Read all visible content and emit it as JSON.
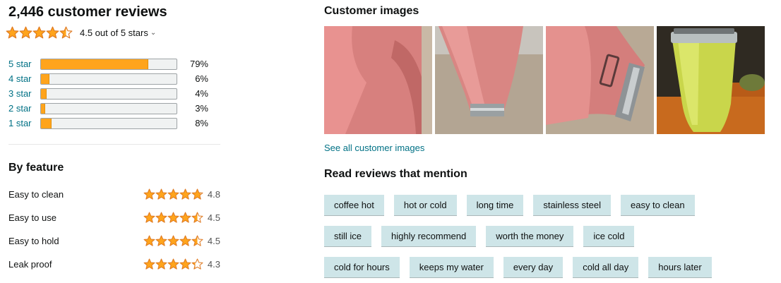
{
  "header": {
    "total_reviews": "2,446 customer reviews",
    "rating_text": "4.5 out of 5 stars",
    "rating_value": 4.5,
    "caret": "⌄"
  },
  "histogram": [
    {
      "label": "5 star",
      "percent_text": "79%",
      "percent": 0.79
    },
    {
      "label": "4 star",
      "percent_text": "6%",
      "percent": 0.06
    },
    {
      "label": "3 star",
      "percent_text": "4%",
      "percent": 0.04
    },
    {
      "label": "2 star",
      "percent_text": "3%",
      "percent": 0.03
    },
    {
      "label": "1 star",
      "percent_text": "8%",
      "percent": 0.08
    }
  ],
  "features": {
    "title": "By feature",
    "items": [
      {
        "name": "Easy to clean",
        "rating": "4.8",
        "value": 4.8
      },
      {
        "name": "Easy to use",
        "rating": "4.5",
        "value": 4.5
      },
      {
        "name": "Easy to hold",
        "rating": "4.5",
        "value": 4.5
      },
      {
        "name": "Leak proof",
        "rating": "4.3",
        "value": 4.3
      }
    ]
  },
  "customer_images": {
    "title": "Customer images",
    "see_all": "See all customer images",
    "images": [
      {
        "name": "pink-tumbler-closeup"
      },
      {
        "name": "pink-tumbler-base"
      },
      {
        "name": "pink-tumbler-logo"
      },
      {
        "name": "green-tumbler"
      }
    ]
  },
  "mentions": {
    "title": "Read reviews that mention",
    "rows": [
      [
        "coffee hot",
        "hot or cold",
        "long time",
        "stainless steel",
        "easy to clean"
      ],
      [
        "still ice",
        "highly recommend",
        "worth the money",
        "ice cold"
      ],
      [
        "cold for hours",
        "keeps my water",
        "every day",
        "cold all day",
        "hours later"
      ]
    ]
  },
  "colors": {
    "star": "#ffa41c",
    "star_outline": "#de7921",
    "link": "#007185",
    "chip_bg": "#cee5e8"
  }
}
